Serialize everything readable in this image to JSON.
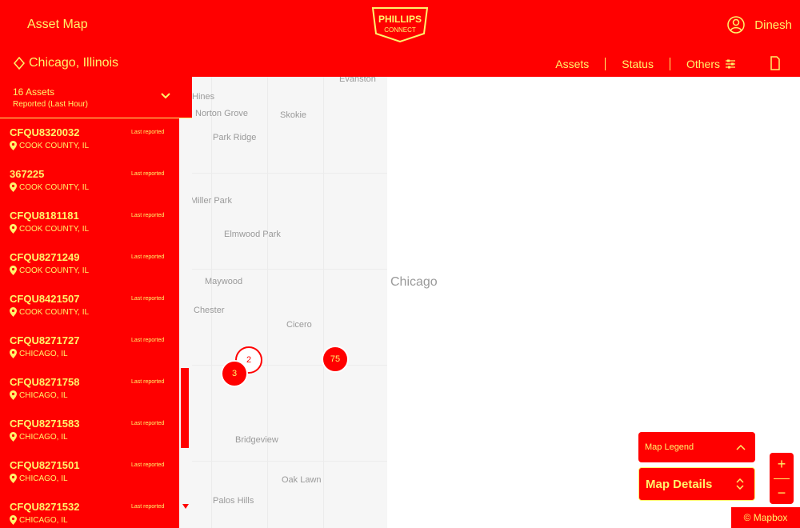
{
  "header": {
    "app_title": "Asset Map",
    "logo_text_top": "PHILLIPS",
    "logo_text_bottom": "CONNECT",
    "user_name": "Dinesh"
  },
  "location_bar": {
    "location": "Chicago, Illinois",
    "nav": [
      {
        "label": "Assets"
      },
      {
        "label": "Status"
      },
      {
        "label": "Others"
      }
    ]
  },
  "sidebar": {
    "count": "16 Assets",
    "subtitle": "Reported (Last Hour)",
    "items": [
      {
        "code": "CFQU8320032",
        "status": "Last reported",
        "place": "COOK COUNTY, IL"
      },
      {
        "code": "367225",
        "status": "Last reported",
        "place": "COOK COUNTY, IL"
      },
      {
        "code": "CFQU8181181",
        "status": "Last reported",
        "place": "COOK COUNTY, IL"
      },
      {
        "code": "CFQU8271249",
        "status": "Last reported",
        "place": "COOK COUNTY, IL"
      },
      {
        "code": "CFQU8421507",
        "status": "Last reported",
        "place": "COOK COUNTY, IL"
      },
      {
        "code": "CFQU8271727",
        "status": "Last reported",
        "place": "CHICAGO, IL"
      },
      {
        "code": "CFQU8271758",
        "status": "Last reported",
        "place": "CHICAGO, IL"
      },
      {
        "code": "CFQU8271583",
        "status": "Last reported",
        "place": "CHICAGO, IL"
      },
      {
        "code": "CFQU8271501",
        "status": "Last reported",
        "place": "CHICAGO, IL"
      },
      {
        "code": "CFQU8271532",
        "status": "Last reported",
        "place": "CHICAGO, IL"
      }
    ]
  },
  "map": {
    "city": "Chicago",
    "towns": [
      "Evanston",
      "Norton Grove",
      "Skokie",
      "Park Ridge",
      "Miller Park",
      "Elmwood Park",
      "Maywood",
      "Chester",
      "Cicero",
      "Bridgeview",
      "Oak Lawn",
      "Palos Hills",
      "Hines"
    ],
    "clusters": [
      "2",
      "3",
      "75"
    ],
    "legend_label": "Map Legend",
    "details_label": "Map Details",
    "zoom_in": "+",
    "zoom_out": "−",
    "attribution": "© Mapbox"
  },
  "colors": {
    "background": "#ff0000",
    "text": "#fff36b",
    "map": "#f6f6f6"
  }
}
